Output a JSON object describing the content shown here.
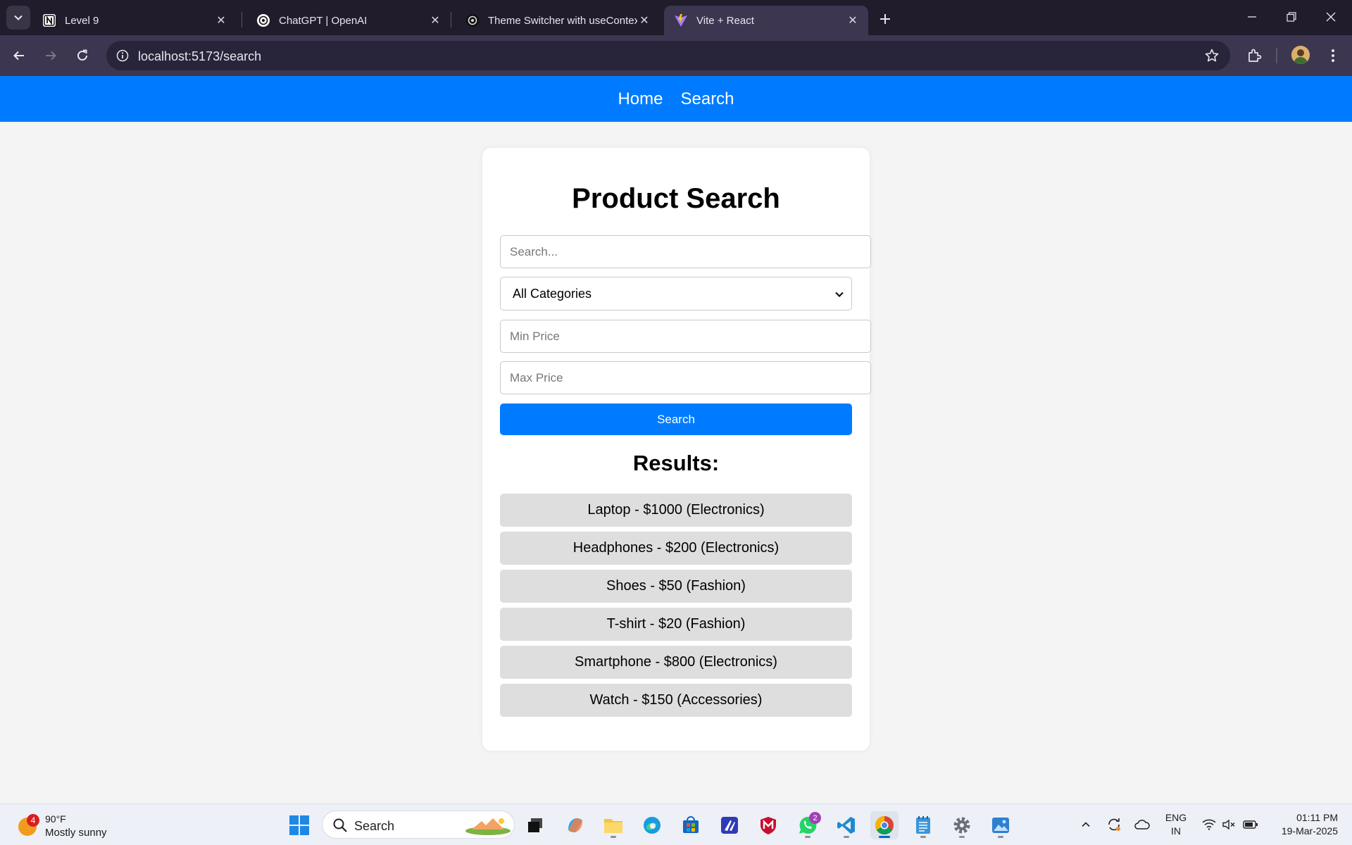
{
  "browser": {
    "tabs": [
      {
        "title": "Level 9",
        "icon": "notion-icon"
      },
      {
        "title": "ChatGPT | OpenAI",
        "icon": "openai-icon"
      },
      {
        "title": "Theme Switcher with useContext",
        "icon": "openai-icon"
      },
      {
        "title": "Vite + React",
        "icon": "vite-icon",
        "active": true
      }
    ],
    "url": "localhost:5173/search"
  },
  "navbar": {
    "links": [
      "Home",
      "Search"
    ]
  },
  "page": {
    "title": "Product Search",
    "search_placeholder": "Search...",
    "category_selected": "All Categories",
    "min_price_placeholder": "Min Price",
    "max_price_placeholder": "Max Price",
    "search_button": "Search",
    "results_heading": "Results:",
    "results": [
      "Laptop - $1000 (Electronics)",
      "Headphones - $200 (Electronics)",
      "Shoes - $50 (Fashion)",
      "T-shirt - $20 (Fashion)",
      "Smartphone - $800 (Electronics)",
      "Watch - $150 (Accessories)"
    ]
  },
  "taskbar": {
    "weather": {
      "badge": "4",
      "temp": "90°F",
      "condition": "Mostly sunny"
    },
    "search_label": "Search",
    "whatsapp_badge": "2",
    "language": {
      "line1": "ENG",
      "line2": "IN"
    },
    "time": "01:11 PM",
    "date": "19-Mar-2025"
  },
  "colors": {
    "accent": "#007bff",
    "result_bg": "#dedede",
    "page_bg": "#f4f4f4"
  }
}
